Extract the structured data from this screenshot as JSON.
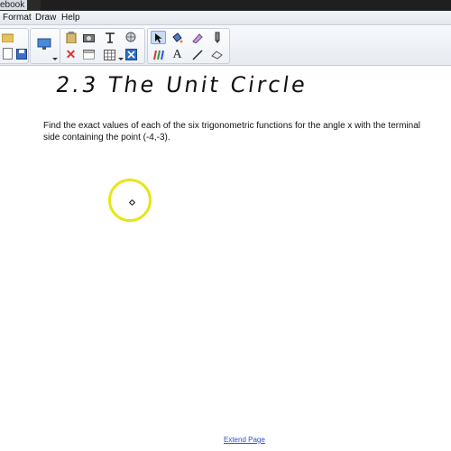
{
  "window": {
    "title": "ebook"
  },
  "menu": {
    "items": [
      "Format",
      "Draw",
      "Help"
    ]
  },
  "page": {
    "handwritten_title": "2.3  The  Unit Circle",
    "problem_text": "Find the exact values of each of the six trigonometric functions for the angle x with the terminal side containing the point (-4,-3).",
    "extend_link": "Extend Page"
  },
  "colors": {
    "pointer_ring": "#e6e618",
    "link": "#2a4fd6",
    "toolbar_selected": "#c8dcf2"
  }
}
